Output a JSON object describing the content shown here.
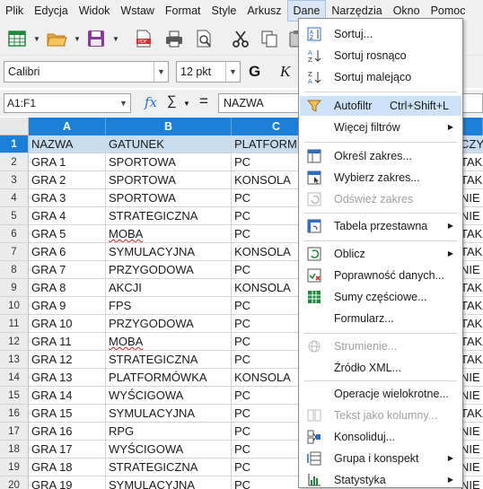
{
  "menubar": [
    "Plik",
    "Edycja",
    "Widok",
    "Wstaw",
    "Format",
    "Style",
    "Arkusz",
    "Dane",
    "Narzędzia",
    "Okno",
    "Pomoc"
  ],
  "font": {
    "name": "Calibri",
    "size": "12 pkt",
    "bold": "G",
    "italic": "K"
  },
  "formula": {
    "namebox": "A1:F1",
    "fx": "fx",
    "sigma": "∑",
    "equals": "=",
    "content": "NAZWA"
  },
  "columns": [
    "A",
    "B",
    "C"
  ],
  "rows": [
    {
      "n": "1",
      "a": "NAZWA",
      "b": "GATUNEK",
      "c": "PLATFORM",
      "r": "CZY"
    },
    {
      "n": "2",
      "a": "GRA 1",
      "b": "SPORTOWA",
      "c": "PC",
      "r": "TAK"
    },
    {
      "n": "3",
      "a": "GRA 2",
      "b": "SPORTOWA",
      "c": "KONSOLA",
      "r": "TAK"
    },
    {
      "n": "4",
      "a": "GRA 3",
      "b": "SPORTOWA",
      "c": "PC",
      "r": "NIE"
    },
    {
      "n": "5",
      "a": "GRA 4",
      "b": "STRATEGICZNA",
      "c": "PC",
      "r": "NIE"
    },
    {
      "n": "6",
      "a": "GRA 5",
      "b": "MOBA",
      "c": "PC",
      "r": "TAK"
    },
    {
      "n": "7",
      "a": "GRA 6",
      "b": "SYMULACYJNA",
      "c": "KONSOLA",
      "r": "TAK"
    },
    {
      "n": "8",
      "a": "GRA 7",
      "b": "PRZYGODOWA",
      "c": "PC",
      "r": "NIE"
    },
    {
      "n": "9",
      "a": "GRA 8",
      "b": "AKCJI",
      "c": "KONSOLA",
      "r": "TAK"
    },
    {
      "n": "10",
      "a": "GRA 9",
      "b": "FPS",
      "c": "PC",
      "r": "TAK"
    },
    {
      "n": "11",
      "a": "GRA 10",
      "b": "PRZYGODOWA",
      "c": "PC",
      "r": "TAK"
    },
    {
      "n": "12",
      "a": "GRA 11",
      "b": "MOBA",
      "c": "PC",
      "r": "TAK"
    },
    {
      "n": "13",
      "a": "GRA 12",
      "b": "STRATEGICZNA",
      "c": "PC",
      "r": "TAK"
    },
    {
      "n": "14",
      "a": "GRA 13",
      "b": "PLATFORMÓWKA",
      "c": "KONSOLA",
      "r": "NIE"
    },
    {
      "n": "15",
      "a": "GRA 14",
      "b": "WYŚCIGOWA",
      "c": "PC",
      "r": "NIE"
    },
    {
      "n": "16",
      "a": "GRA 15",
      "b": "SYMULACYJNA",
      "c": "PC",
      "r": "TAK"
    },
    {
      "n": "17",
      "a": "GRA 16",
      "b": "RPG",
      "c": "PC",
      "r": "NIE"
    },
    {
      "n": "18",
      "a": "GRA 17",
      "b": "WYŚCIGOWA",
      "c": "PC",
      "r": "NIE"
    },
    {
      "n": "19",
      "a": "GRA 18",
      "b": "STRATEGICZNA",
      "c": "PC",
      "r": "NIE"
    },
    {
      "n": "20",
      "a": "GRA 19",
      "b": "SYMULACYJNA",
      "c": "PC",
      "r": "NIE"
    }
  ],
  "menu": {
    "sortuj": "Sortuj...",
    "sortuj_rosnaco": "Sortuj rosnąco",
    "sortuj_malejaco": "Sortuj malejąco",
    "autofiltr": "Autofiltr",
    "autofiltr_shortcut": "Ctrl+Shift+L",
    "wiecej_filtrow": "Więcej filtrów",
    "okresl_zakres": "Określ zakres...",
    "wybierz_zakres": "Wybierz zakres...",
    "odswiez_zakres": "Odśwież zakres",
    "tabela_przestawna": "Tabela przestawna",
    "oblicz": "Oblicz",
    "poprawnosc": "Poprawność danych...",
    "sumy": "Sumy częściowe...",
    "formularz": "Formularz...",
    "strumienie": "Strumienie...",
    "zrodlo_xml": "Źródło XML...",
    "operacje": "Operacje wielokrotne...",
    "tekst_kolumny": "Tekst jako kolumny...",
    "konsoliduj": "Konsoliduj...",
    "grupa": "Grupa i konspekt",
    "statystyka": "Statystyka"
  }
}
